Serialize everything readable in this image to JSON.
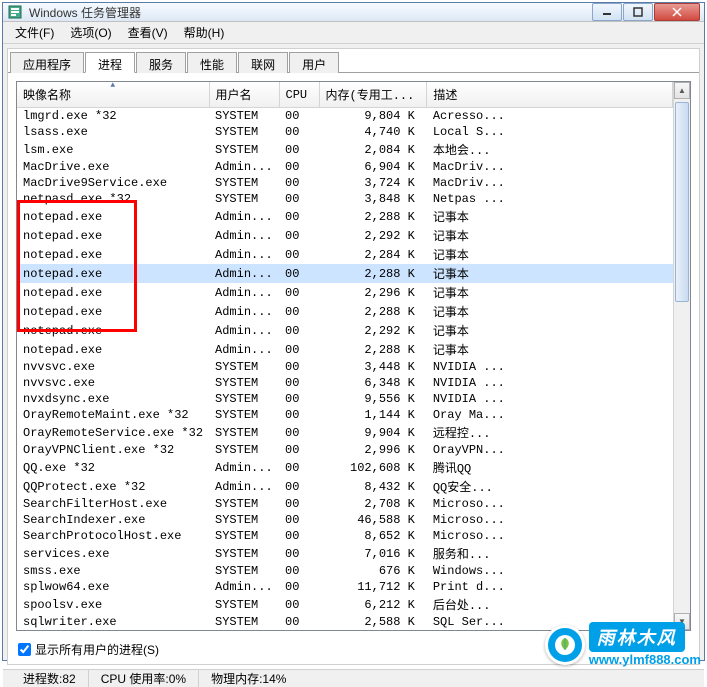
{
  "window": {
    "title": "Windows 任务管理器"
  },
  "menu": {
    "file": "文件(F)",
    "options": "选项(O)",
    "view": "查看(V)",
    "help": "帮助(H)"
  },
  "tabs": {
    "apps": "应用程序",
    "processes": "进程",
    "services": "服务",
    "perf": "性能",
    "net": "联网",
    "users": "用户"
  },
  "columns": {
    "name": "映像名称",
    "user": "用户名",
    "cpu": "CPU",
    "mem": "内存(专用工...",
    "desc": "描述"
  },
  "processes": [
    {
      "name": "lmgrd.exe *32",
      "user": "SYSTEM",
      "cpu": "00",
      "mem": "9,804 K",
      "desc": "Acresso..."
    },
    {
      "name": "lsass.exe",
      "user": "SYSTEM",
      "cpu": "00",
      "mem": "4,740 K",
      "desc": "Local S..."
    },
    {
      "name": "lsm.exe",
      "user": "SYSTEM",
      "cpu": "00",
      "mem": "2,084 K",
      "desc": "本地会..."
    },
    {
      "name": "MacDrive.exe",
      "user": "Admin...",
      "cpu": "00",
      "mem": "6,904 K",
      "desc": "MacDriv..."
    },
    {
      "name": "MacDrive9Service.exe",
      "user": "SYSTEM",
      "cpu": "00",
      "mem": "3,724 K",
      "desc": "MacDriv..."
    },
    {
      "name": "netpasd.exe *32",
      "user": "SYSTEM",
      "cpu": "00",
      "mem": "3,848 K",
      "desc": "Netpas ..."
    },
    {
      "name": "notepad.exe",
      "user": "Admin...",
      "cpu": "00",
      "mem": "2,288 K",
      "desc": "记事本",
      "hl": true
    },
    {
      "name": "notepad.exe",
      "user": "Admin...",
      "cpu": "00",
      "mem": "2,292 K",
      "desc": "记事本",
      "hl": true
    },
    {
      "name": "notepad.exe",
      "user": "Admin...",
      "cpu": "00",
      "mem": "2,284 K",
      "desc": "记事本",
      "hl": true
    },
    {
      "name": "notepad.exe",
      "user": "Admin...",
      "cpu": "00",
      "mem": "2,288 K",
      "desc": "记事本",
      "hl": true,
      "selected": true
    },
    {
      "name": "notepad.exe",
      "user": "Admin...",
      "cpu": "00",
      "mem": "2,296 K",
      "desc": "记事本",
      "hl": true
    },
    {
      "name": "notepad.exe",
      "user": "Admin...",
      "cpu": "00",
      "mem": "2,288 K",
      "desc": "记事本",
      "hl": true
    },
    {
      "name": "notepad.exe",
      "user": "Admin...",
      "cpu": "00",
      "mem": "2,292 K",
      "desc": "记事本",
      "hl": true
    },
    {
      "name": "notepad.exe",
      "user": "Admin...",
      "cpu": "00",
      "mem": "2,288 K",
      "desc": "记事本",
      "hl": true
    },
    {
      "name": "nvvsvc.exe",
      "user": "SYSTEM",
      "cpu": "00",
      "mem": "3,448 K",
      "desc": "NVIDIA ..."
    },
    {
      "name": "nvvsvc.exe",
      "user": "SYSTEM",
      "cpu": "00",
      "mem": "6,348 K",
      "desc": "NVIDIA ..."
    },
    {
      "name": "nvxdsync.exe",
      "user": "SYSTEM",
      "cpu": "00",
      "mem": "9,556 K",
      "desc": "NVIDIA ..."
    },
    {
      "name": "OrayRemoteMaint.exe *32",
      "user": "SYSTEM",
      "cpu": "00",
      "mem": "1,144 K",
      "desc": "Oray Ma..."
    },
    {
      "name": "OrayRemoteService.exe *32",
      "user": "SYSTEM",
      "cpu": "00",
      "mem": "9,904 K",
      "desc": "远程控..."
    },
    {
      "name": "OrayVPNClient.exe *32",
      "user": "SYSTEM",
      "cpu": "00",
      "mem": "2,996 K",
      "desc": "OrayVPN..."
    },
    {
      "name": "QQ.exe *32",
      "user": "Admin...",
      "cpu": "00",
      "mem": "102,608 K",
      "desc": "腾讯QQ"
    },
    {
      "name": "QQProtect.exe *32",
      "user": "Admin...",
      "cpu": "00",
      "mem": "8,432 K",
      "desc": "QQ安全..."
    },
    {
      "name": "SearchFilterHost.exe",
      "user": "SYSTEM",
      "cpu": "00",
      "mem": "2,708 K",
      "desc": "Microso..."
    },
    {
      "name": "SearchIndexer.exe",
      "user": "SYSTEM",
      "cpu": "00",
      "mem": "46,588 K",
      "desc": "Microso..."
    },
    {
      "name": "SearchProtocolHost.exe",
      "user": "SYSTEM",
      "cpu": "00",
      "mem": "8,652 K",
      "desc": "Microso..."
    },
    {
      "name": "services.exe",
      "user": "SYSTEM",
      "cpu": "00",
      "mem": "7,016 K",
      "desc": "服务和..."
    },
    {
      "name": "smss.exe",
      "user": "SYSTEM",
      "cpu": "00",
      "mem": "676 K",
      "desc": "Windows..."
    },
    {
      "name": "splwow64.exe",
      "user": "Admin...",
      "cpu": "00",
      "mem": "11,712 K",
      "desc": "Print d..."
    },
    {
      "name": "spoolsv.exe",
      "user": "SYSTEM",
      "cpu": "00",
      "mem": "6,212 K",
      "desc": "后台处..."
    },
    {
      "name": "sqlwriter.exe",
      "user": "SYSTEM",
      "cpu": "00",
      "mem": "2,588 K",
      "desc": "SQL Ser..."
    }
  ],
  "checkbox": {
    "label": "显示所有用户的进程(S)",
    "checked": true
  },
  "status": {
    "procs_label": "进程数:",
    "procs_val": "82",
    "cpu_label": "CPU 使用率:",
    "cpu_val": "0%",
    "mem_label": "物理内存:",
    "mem_val": "14%"
  },
  "watermark": {
    "cn": "雨林木风",
    "url": "www.ylmf888.com",
    "badge": "Y"
  }
}
